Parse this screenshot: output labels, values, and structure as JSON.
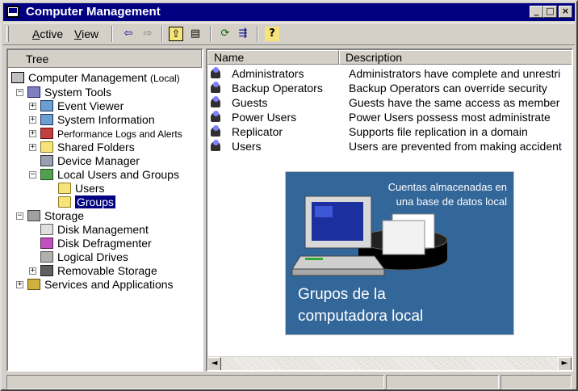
{
  "window": {
    "title": "Computer Management",
    "controls": {
      "minimize": "_",
      "maximize": "□",
      "close": "×"
    }
  },
  "toolbar": {
    "menu": [
      {
        "label": "Active",
        "underline": "A",
        "rest": "ctive"
      },
      {
        "label": "View",
        "underline": "V",
        "rest": "iew"
      }
    ],
    "buttons": [
      {
        "name": "back-arrow-icon",
        "glyph": "⇦"
      },
      {
        "name": "forward-arrow-icon",
        "glyph": "⇨"
      },
      {
        "name": "up-folder-icon",
        "glyph": "⇪"
      },
      {
        "name": "show-hide-tree-icon",
        "glyph": "▤"
      },
      {
        "name": "refresh-icon",
        "glyph": "⟳"
      },
      {
        "name": "export-list-icon",
        "glyph": "⇶"
      },
      {
        "name": "help-icon",
        "glyph": "?"
      }
    ]
  },
  "tree": {
    "header": "Tree",
    "nodes": [
      {
        "label": "Computer Management",
        "suffix": "(Local)",
        "icon": "computer",
        "depth": 0
      },
      {
        "label": "System Tools",
        "icon": "tools",
        "depth": 1,
        "expander": "−"
      },
      {
        "label": "Event Viewer",
        "icon": "system",
        "depth": 2,
        "expander": "+"
      },
      {
        "label": "System Information",
        "icon": "system",
        "depth": 2,
        "expander": "+"
      },
      {
        "label": "Performance Logs and Alerts",
        "icon": "perf",
        "depth": 2,
        "expander": "+",
        "small": true
      },
      {
        "label": "Shared Folders",
        "icon": "folder",
        "depth": 2,
        "expander": "+"
      },
      {
        "label": "Device Manager",
        "icon": "device",
        "depth": 2
      },
      {
        "label": "Local Users and Groups",
        "icon": "users",
        "depth": 2,
        "expander": "−"
      },
      {
        "label": "Users",
        "icon": "folder",
        "depth": 3
      },
      {
        "label": "Groups",
        "icon": "folder",
        "depth": 3,
        "selected": true
      },
      {
        "label": "Storage",
        "icon": "storage",
        "depth": 1,
        "expander": "−"
      },
      {
        "label": "Disk Management",
        "icon": "disk",
        "depth": 2
      },
      {
        "label": "Disk Defragmenter",
        "icon": "defrag",
        "depth": 2
      },
      {
        "label": "Logical Drives",
        "icon": "drives",
        "depth": 2
      },
      {
        "label": "Removable Storage",
        "icon": "removable",
        "depth": 2,
        "expander": "+"
      },
      {
        "label": "Services and Applications",
        "icon": "services",
        "depth": 1,
        "expander": "+"
      }
    ]
  },
  "list": {
    "columns": [
      "Name",
      "Description"
    ],
    "rows": [
      {
        "name": "Administrators",
        "description": "Administrators have complete and unrestri"
      },
      {
        "name": "Backup Operators",
        "description": "Backup Operators can override security"
      },
      {
        "name": "Guests",
        "description": "Guests have the same access as member"
      },
      {
        "name": "Power Users",
        "description": "Power Users possess most administrate"
      },
      {
        "name": "Replicator",
        "description": "Supports file replication in a domain"
      },
      {
        "name": "Users",
        "description": "Users are prevented from making accident"
      }
    ],
    "scroll_left": "◄",
    "scroll_right": "►"
  },
  "illustration": {
    "top_text": "Cuentas almacenadas en una base de datos local",
    "bottom_text": "Grupos de la computadora local",
    "background": "#336699"
  },
  "status": [
    "",
    "",
    ""
  ]
}
